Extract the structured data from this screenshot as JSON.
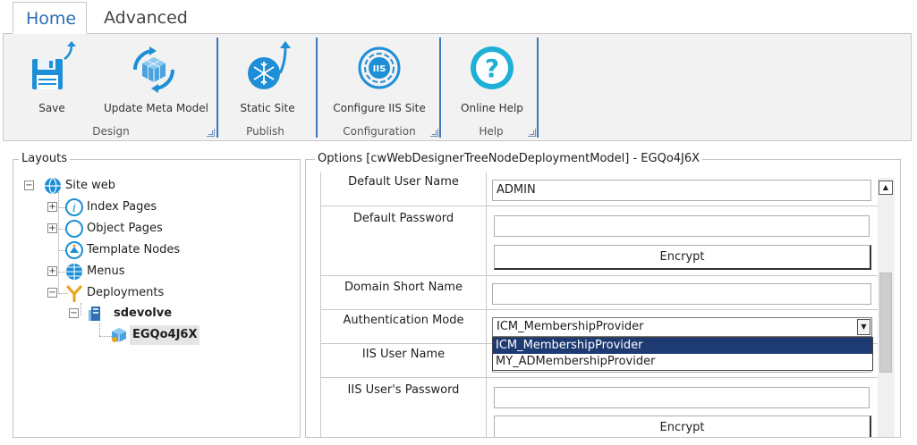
{
  "tabs": [
    {
      "label": "Home",
      "active": true
    },
    {
      "label": "Advanced",
      "active": false
    }
  ],
  "ribbon": {
    "groups": [
      {
        "label": "Design",
        "buttons": [
          {
            "label": "Save",
            "icon": "save-icon"
          },
          {
            "label": "Update Meta Model",
            "icon": "update-meta-model-icon"
          }
        ]
      },
      {
        "label": "Publish",
        "buttons": [
          {
            "label": "Static Site",
            "icon": "static-site-icon"
          }
        ]
      },
      {
        "label": "Configuration",
        "buttons": [
          {
            "label": "Configure IIS Site",
            "icon": "configure-iis-icon"
          }
        ]
      },
      {
        "label": "Help",
        "buttons": [
          {
            "label": "Online Help",
            "icon": "help-icon"
          }
        ]
      }
    ],
    "accent_color": "#1e8fd6"
  },
  "layouts": {
    "title": "Layouts",
    "tree": [
      {
        "label": "Site web",
        "icon": "globe-icon",
        "expander": "−"
      },
      {
        "label": "Index Pages",
        "icon": "info-icon",
        "expander": "+"
      },
      {
        "label": "Object Pages",
        "icon": "object-page-icon",
        "expander": "+"
      },
      {
        "label": "Template Nodes",
        "icon": "template-icon",
        "expander": ""
      },
      {
        "label": "Menus",
        "icon": "menu-globe-icon",
        "expander": "+"
      },
      {
        "label": "Deployments",
        "icon": "deployment-icon",
        "expander": "−"
      },
      {
        "label": "sdevolve",
        "icon": "server-icon",
        "expander": "−"
      },
      {
        "label": "EGQo4J6X",
        "icon": "deployment-model-icon",
        "expander": ""
      }
    ]
  },
  "options": {
    "title": "Options [cwWebDesignerTreeNodeDeploymentModel] - EGQo4J6X",
    "rows": {
      "default_user_name": {
        "label": "Default User Name",
        "value": "ADMIN"
      },
      "default_password": {
        "label": "Default Password",
        "value": "",
        "button": "Encrypt"
      },
      "domain_short_name": {
        "label": "Domain Short Name",
        "value": ""
      },
      "authentication_mode": {
        "label": "Authentication Mode",
        "value": "ICM_MembershipProvider",
        "options": [
          "ICM_MembershipProvider",
          "MY_ADMembershipProvider"
        ]
      },
      "iis_user_name": {
        "label": "IIS User Name",
        "value": ""
      },
      "iis_user_password": {
        "label": "IIS User's Password",
        "value": "",
        "button": "Encrypt"
      }
    }
  }
}
